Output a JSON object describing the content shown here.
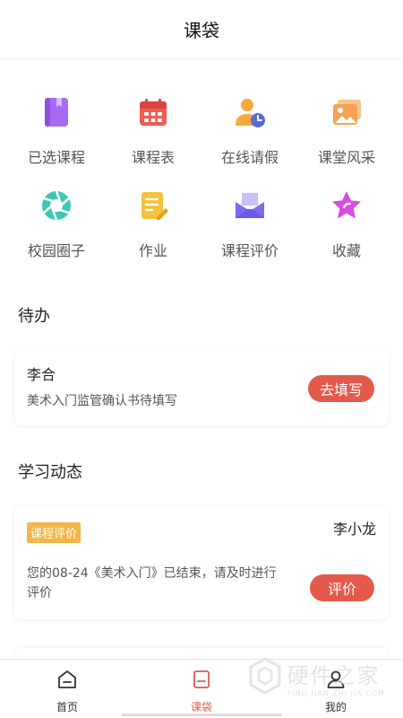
{
  "header": {
    "title": "课袋"
  },
  "grid": [
    {
      "label": "已选课程",
      "icon": "book-icon",
      "color": "#a66bf0"
    },
    {
      "label": "课程表",
      "icon": "calendar-icon",
      "color": "#ef5b55"
    },
    {
      "label": "在线请假",
      "icon": "user-clock-icon",
      "color": "#f5a93a"
    },
    {
      "label": "课堂风采",
      "icon": "image-gallery-icon",
      "color": "#f3a353"
    },
    {
      "label": "校园圈子",
      "icon": "aperture-icon",
      "color": "#3cc7b4"
    },
    {
      "label": "作业",
      "icon": "document-edit-icon",
      "color": "#f4c23d"
    },
    {
      "label": "课程评价",
      "icon": "mailbox-icon",
      "color": "#7b6bef"
    },
    {
      "label": "收藏",
      "icon": "star-icon",
      "color": "#d44fe0"
    }
  ],
  "todo": {
    "title": "待办",
    "item": {
      "name": "李合",
      "desc": "美术入门监管确认书待填写",
      "button": "去填写"
    }
  },
  "study": {
    "title": "学习动态",
    "item": {
      "tag": "课程评价",
      "teacher": "李小龙",
      "desc": "您的08-24《美术入门》已结束，请及时进行评价",
      "button": "评价"
    }
  },
  "tabbar": [
    {
      "label": "首页",
      "icon": "home-icon",
      "active": false
    },
    {
      "label": "课袋",
      "icon": "bag-icon",
      "active": true
    },
    {
      "label": "我的",
      "icon": "profile-icon",
      "active": false
    }
  ],
  "watermark": {
    "main": "硬件之家",
    "sub": "YING JIAN ZHI JIA.COM"
  },
  "colors": {
    "accent": "#e35a4c",
    "tag": "#f1b64b"
  }
}
